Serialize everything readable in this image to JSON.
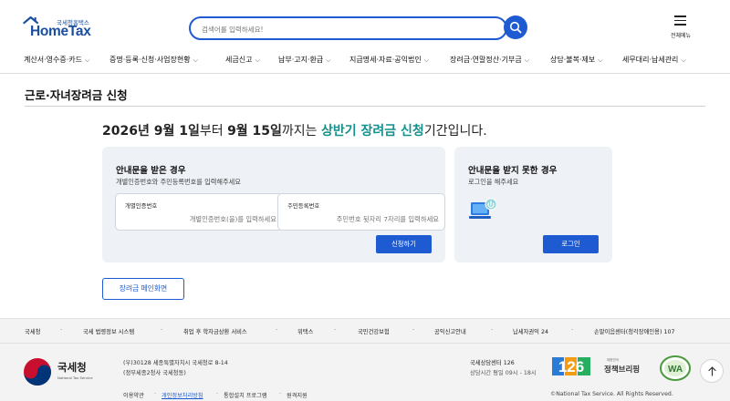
{
  "header": {
    "logo_sub": "국세청홈택스",
    "logo_main": "HomeTax",
    "search_placeholder": "검색어를 입력하세요!",
    "all_menu_label": "전체메뉴"
  },
  "nav": {
    "items": [
      {
        "label": "계산서·영수증·카드"
      },
      {
        "label": "증명·등록·신청·사업장현황"
      },
      {
        "label": "세금신고"
      },
      {
        "label": "납부·고지·환급"
      },
      {
        "label": "지급명세·자료·공익법인"
      },
      {
        "label": "장려금·연말정산·기부금"
      },
      {
        "label": "상담·불복·제보"
      },
      {
        "label": "세무대리·납세관리"
      }
    ]
  },
  "page": {
    "title": "근로·자녀장려금 신청",
    "headline": {
      "d1": "2026년 9월 1일",
      "t1": "부터 ",
      "d2": "9월 15일",
      "t2": "까지는 ",
      "hl": "상반기 장려금 신청",
      "t3": "기간입니다."
    }
  },
  "card_notice": {
    "title": "안내문을 받은 경우",
    "desc": "개별인증번호와 주민등록번호를 입력해주세요",
    "field_auth_label": "개별인증번호",
    "field_auth_placeholder": "개별인증번호(을)를 입력하세요",
    "field_rrn_label": "주민등록번호",
    "field_rrn_placeholder": "주민번호 뒷자리 7자리를 입력하세요",
    "apply_button": "신청하기"
  },
  "card_login": {
    "title": "안내문을 받지 못한 경우",
    "desc": "로그인을 해주세요",
    "login_button": "로그인"
  },
  "main_button": "장려금 메인화면",
  "footer": {
    "links": [
      "국세청",
      "국세 법령정보 시스템",
      "취업 후 학자금상환 서비스",
      "위택스",
      "국민건강보험",
      "공익신고안내",
      "납세자권익 24",
      "손말이음센터(청각장애인용) 107"
    ],
    "org_name": "국세청",
    "org_en": "National Tax Service",
    "address1": "(우)30128 세종특별자치시 국세청로 8-14",
    "address2": "(정부세종2청사 국세청동)",
    "center_name": "국세상담센터 126",
    "center_time": "상담시간 평일 09시 - 18시",
    "logo_126": "126",
    "policy_small": "대한민국",
    "policy_big": "정책브리핑",
    "wa_mark": "WA",
    "bottom_links": [
      "이용약관",
      "개인정보처리방침",
      "통합설치 프로그램",
      "원격지원"
    ],
    "copyright": "©National Tax Service. All Rights Reserved."
  },
  "colors": {
    "brand_blue": "#1e5bd3",
    "highlight_teal": "#13918c",
    "card_bg": "#eef1f6"
  }
}
